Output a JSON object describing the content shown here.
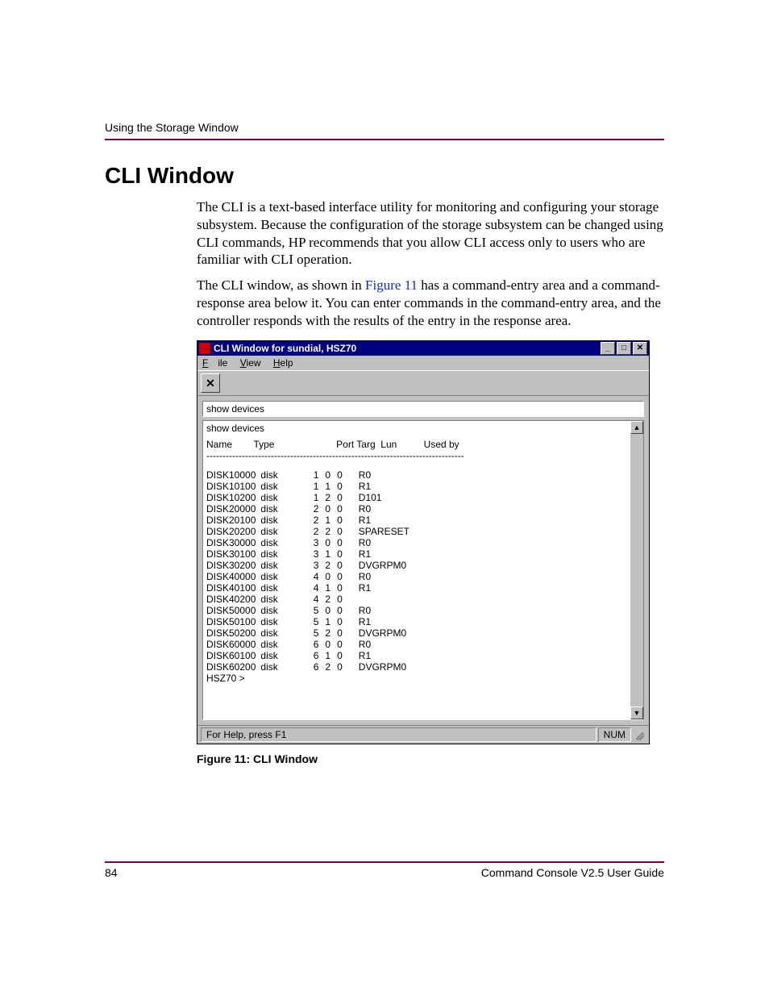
{
  "header": {
    "running_head": "Using the Storage Window"
  },
  "section": {
    "title": "CLI Window"
  },
  "paragraphs": {
    "p1": "The CLI is a text-based interface utility for monitoring and configuring your storage subsystem. Because the configuration of the storage subsystem can be changed using CLI commands, HP recommends that you allow CLI access only to users who are familiar with CLI operation.",
    "p2a": "The CLI window, as shown in ",
    "p2_link": "Figure 11",
    "p2b": " has a command-entry area and a command-response area below it. You can enter commands in the command-entry area, and the controller responds with the results of the entry in the response area."
  },
  "cli_window": {
    "title": "CLI Window for sundial, HSZ70",
    "menus": {
      "file": "File",
      "view": "View",
      "help": "Help"
    },
    "toolbar": {
      "close_glyph": "✕"
    },
    "winbtns": {
      "min": "_",
      "max": "□",
      "close": "✕"
    },
    "command_input": "show devices",
    "output_echo": "show devices",
    "columns_line": "Name        Type                       Port Targ  Lun          Used by",
    "dashes": "--------------------------------------------------------------------------------",
    "rows": [
      {
        "name": "DISK10000",
        "type": "disk",
        "port": 1,
        "targ": 0,
        "lun": 0,
        "used_by": "R0"
      },
      {
        "name": "DISK10100",
        "type": "disk",
        "port": 1,
        "targ": 1,
        "lun": 0,
        "used_by": "R1"
      },
      {
        "name": "DISK10200",
        "type": "disk",
        "port": 1,
        "targ": 2,
        "lun": 0,
        "used_by": "D101"
      },
      {
        "name": "DISK20000",
        "type": "disk",
        "port": 2,
        "targ": 0,
        "lun": 0,
        "used_by": "R0"
      },
      {
        "name": "DISK20100",
        "type": "disk",
        "port": 2,
        "targ": 1,
        "lun": 0,
        "used_by": "R1"
      },
      {
        "name": "DISK20200",
        "type": "disk",
        "port": 2,
        "targ": 2,
        "lun": 0,
        "used_by": "SPARESET"
      },
      {
        "name": "DISK30000",
        "type": "disk",
        "port": 3,
        "targ": 0,
        "lun": 0,
        "used_by": "R0"
      },
      {
        "name": "DISK30100",
        "type": "disk",
        "port": 3,
        "targ": 1,
        "lun": 0,
        "used_by": "R1"
      },
      {
        "name": "DISK30200",
        "type": "disk",
        "port": 3,
        "targ": 2,
        "lun": 0,
        "used_by": "DVGRPM0"
      },
      {
        "name": "DISK40000",
        "type": "disk",
        "port": 4,
        "targ": 0,
        "lun": 0,
        "used_by": "R0"
      },
      {
        "name": "DISK40100",
        "type": "disk",
        "port": 4,
        "targ": 1,
        "lun": 0,
        "used_by": "R1"
      },
      {
        "name": "DISK40200",
        "type": "disk",
        "port": 4,
        "targ": 2,
        "lun": 0,
        "used_by": ""
      },
      {
        "name": "DISK50000",
        "type": "disk",
        "port": 5,
        "targ": 0,
        "lun": 0,
        "used_by": "R0"
      },
      {
        "name": "DISK50100",
        "type": "disk",
        "port": 5,
        "targ": 1,
        "lun": 0,
        "used_by": "R1"
      },
      {
        "name": "DISK50200",
        "type": "disk",
        "port": 5,
        "targ": 2,
        "lun": 0,
        "used_by": "DVGRPM0"
      },
      {
        "name": "DISK60000",
        "type": "disk",
        "port": 6,
        "targ": 0,
        "lun": 0,
        "used_by": "R0"
      },
      {
        "name": "DISK60100",
        "type": "disk",
        "port": 6,
        "targ": 1,
        "lun": 0,
        "used_by": "R1"
      },
      {
        "name": "DISK60200",
        "type": "disk",
        "port": 6,
        "targ": 2,
        "lun": 0,
        "used_by": "DVGRPM0"
      }
    ],
    "prompt": "HSZ70 >",
    "status_left": "For Help, press F1",
    "status_num": "NUM"
  },
  "figure": {
    "caption": "Figure 11:  CLI Window"
  },
  "footer": {
    "page_number": "84",
    "book_title": "Command Console V2.5 User Guide"
  }
}
